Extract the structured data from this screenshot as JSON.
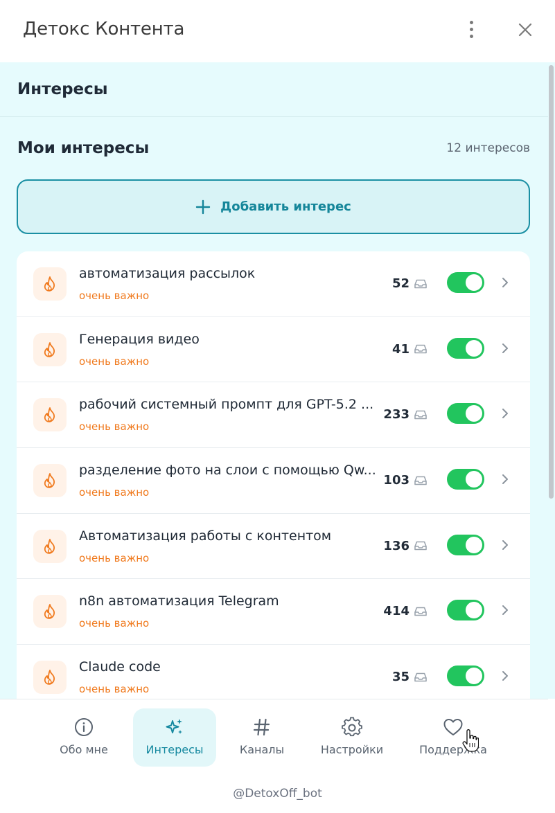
{
  "window": {
    "title": "Детокс Контента"
  },
  "section": {
    "title": "Интересы"
  },
  "my_interests": {
    "title": "Мои интересы",
    "count_label": "12 интересов",
    "add_button_label": "Добавить интерес"
  },
  "interests": [
    {
      "name": "автоматизация рассылок",
      "priority": "очень важно",
      "count": "52",
      "enabled": true
    },
    {
      "name": "Генерация видео",
      "priority": "очень важно",
      "count": "41",
      "enabled": true
    },
    {
      "name": "рабочий системный промпт для GPT-5.2 ...",
      "priority": "очень важно",
      "count": "233",
      "enabled": true
    },
    {
      "name": "разделение фото на слои с помощью Qw...",
      "priority": "очень важно",
      "count": "103",
      "enabled": true
    },
    {
      "name": "Автоматизация работы с контентом",
      "priority": "очень важно",
      "count": "136",
      "enabled": true
    },
    {
      "name": "n8n автоматизация Telegram",
      "priority": "очень важно",
      "count": "414",
      "enabled": true
    },
    {
      "name": "Claude code",
      "priority": "очень важно",
      "count": "35",
      "enabled": true
    }
  ],
  "nav": {
    "about": "Обо мне",
    "interests": "Интересы",
    "channels": "Каналы",
    "settings": "Настройки",
    "support": "Поддержка",
    "active": "interests"
  },
  "footer": {
    "handle": "@DetoxOff_bot"
  },
  "colors": {
    "accent": "#15869a",
    "content_bg": "#e6fbfd",
    "toggle_on": "#22c55e",
    "priority": "#f07a1e"
  },
  "icons": {
    "menu": "kebab-menu-icon",
    "close": "close-icon",
    "add": "plus-icon",
    "item": "flame-icon",
    "inbox": "inbox-icon",
    "chevron": "chevron-right-icon",
    "about": "info-icon",
    "interests": "sparkles-icon",
    "channels": "hash-icon",
    "settings": "gear-icon",
    "support": "heart-icon"
  }
}
